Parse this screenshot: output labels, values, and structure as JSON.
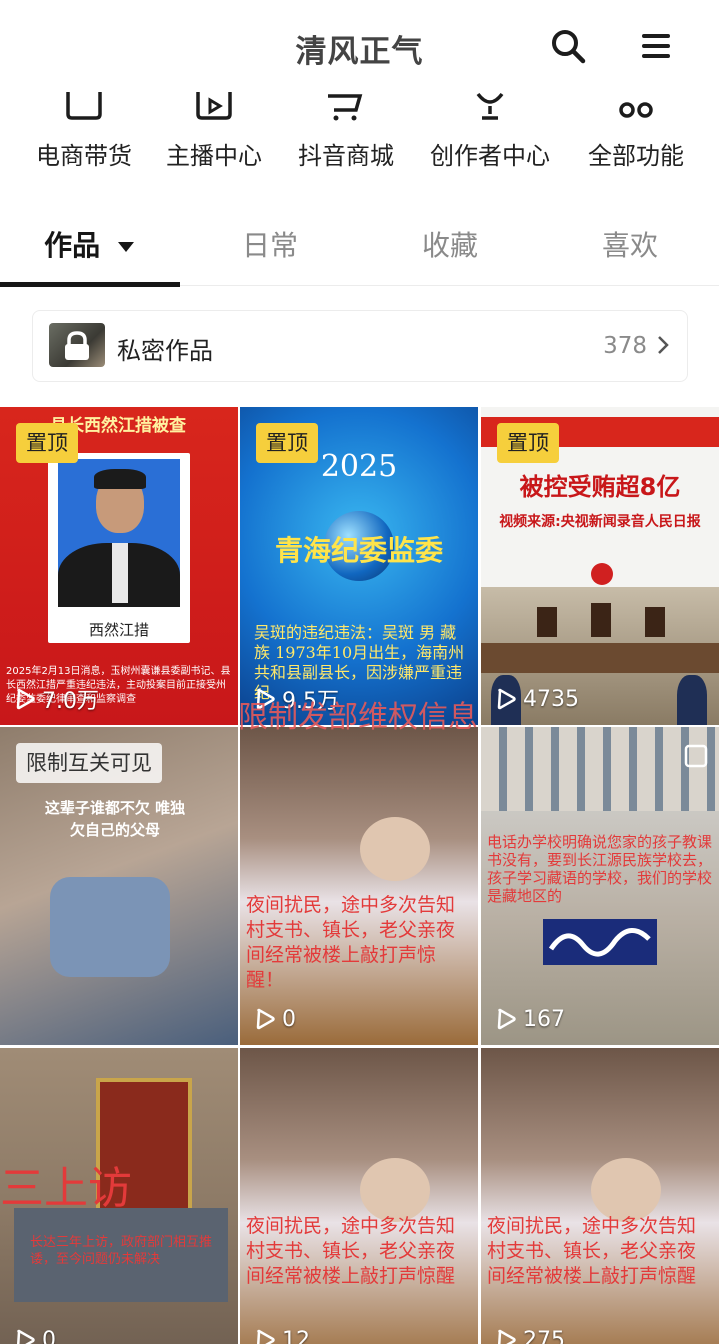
{
  "header": {
    "title": "清风正气"
  },
  "features": [
    {
      "label": "电商带货",
      "icon": "bag-icon"
    },
    {
      "label": "主播中心",
      "icon": "video-icon"
    },
    {
      "label": "抖音商城",
      "icon": "cart-icon"
    },
    {
      "label": "创作者中心",
      "icon": "bulb-icon"
    },
    {
      "label": "全部功能",
      "icon": "grid-icon"
    }
  ],
  "tabs": [
    {
      "label": "作品"
    },
    {
      "label": "日常"
    },
    {
      "label": "收藏"
    },
    {
      "label": "喜欢"
    }
  ],
  "private_works": {
    "label": "私密作品",
    "count": "378"
  },
  "watermark": "限制发部维权信息",
  "videos": [
    {
      "badge": "置顶",
      "plays": "7.0万",
      "caption_top": "县长西然江措被查",
      "caption_name": "西然江措",
      "caption_body": "2025年2月13日消息，玉树州囊谦县委副书记、县长西然江措严重违纪违法，主动投案目前正接受州纪委监委纪律审查和监察调查"
    },
    {
      "badge": "置顶",
      "plays": "9.5万",
      "caption_year": "2025",
      "caption_title": "青海纪委监委",
      "caption_body": "吴斑的违纪违法：吴斑 男 藏族 1973年10月出生，海南州共和县副县长，因涉嫌严重违纪"
    },
    {
      "badge": "置顶",
      "plays": "4735",
      "caption_top": "被控受贿超8亿",
      "caption_sub": "视频来源:央视新闻录音人民日报"
    },
    {
      "badge": "限制互关可见",
      "plays": "",
      "caption_body": "这辈子谁都不欠 唯独欠自己的父母"
    },
    {
      "badge": "",
      "plays": "0",
      "caption_body": "夜间扰民，途中多次告知村支书、镇长，老父亲夜间经常被楼上敲打声惊醒！"
    },
    {
      "badge": "",
      "plays": "167",
      "caption_body": "电话办学校明确说您家的孩子教课书没有，要到长江源民族学校去，孩子学习藏语的学校，我们的学校是藏地区的"
    },
    {
      "badge": "",
      "plays": "0",
      "caption_top": "三上访",
      "caption_body": "长达三年上访，政府部门相互推诿，至今问题仍未解决"
    },
    {
      "badge": "",
      "plays": "12",
      "caption_body": "夜间扰民，途中多次告知村支书、镇长，老父亲夜间经常被楼上敲打声惊醒"
    },
    {
      "badge": "",
      "plays": "275",
      "caption_body": "夜间扰民，途中多次告知村支书、镇长，老父亲夜间经常被楼上敲打声惊醒"
    }
  ]
}
